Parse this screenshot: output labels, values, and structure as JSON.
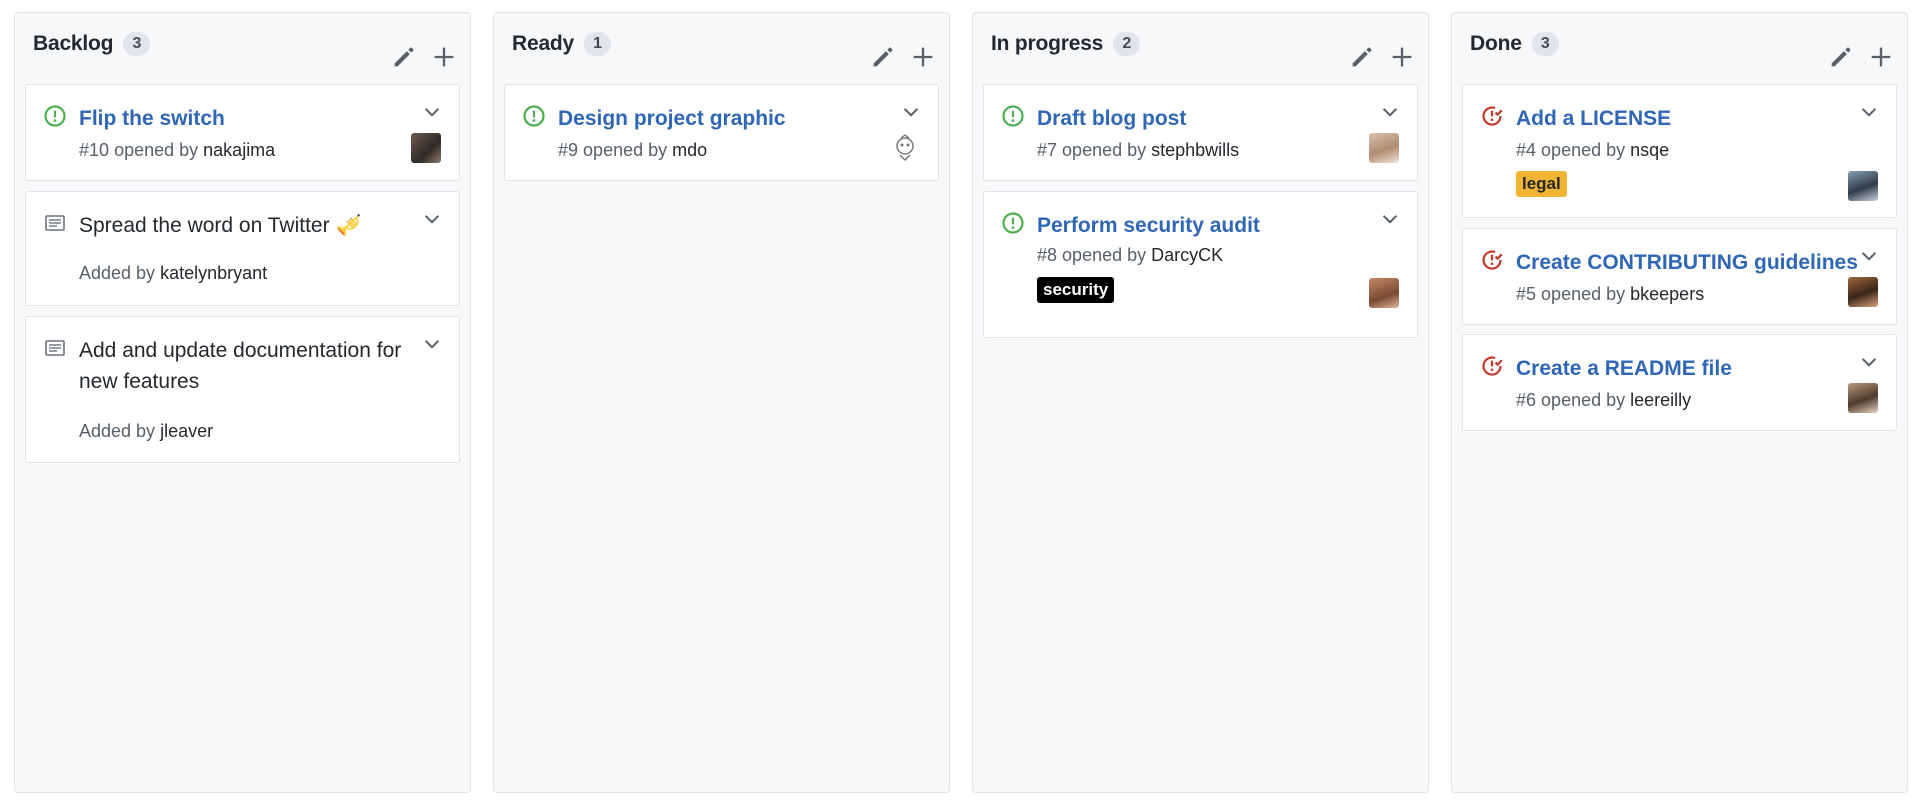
{
  "colors": {
    "open_issue": "#28a745",
    "closed_issue": "#cb2431",
    "link": "#2f67b4",
    "legal_label_bg": "#f1b434",
    "security_label_bg": "#000000"
  },
  "columns": [
    {
      "title": "Backlog",
      "count": "3",
      "cards": [
        {
          "type": "issue-open",
          "title": "Flip the switch",
          "number": "#10",
          "opened_by_text": "opened by",
          "user": "nakajima"
        },
        {
          "type": "note",
          "title": "Spread the word on Twitter",
          "emoji": "🎺",
          "added_by_text": "Added by",
          "user": "katelynbryant"
        },
        {
          "type": "note",
          "title": "Add and update documentation for new features",
          "added_by_text": "Added by",
          "user": "jleaver"
        }
      ]
    },
    {
      "title": "Ready",
      "count": "1",
      "cards": [
        {
          "type": "issue-open",
          "title": "Design project graphic",
          "number": "#9",
          "opened_by_text": "opened by",
          "user": "mdo"
        }
      ]
    },
    {
      "title": "In progress",
      "count": "2",
      "cards": [
        {
          "type": "issue-open",
          "title": "Draft blog post",
          "number": "#7",
          "opened_by_text": "opened by",
          "user": "stephbwills"
        },
        {
          "type": "issue-open",
          "title": "Perform security audit",
          "number": "#8",
          "opened_by_text": "opened by",
          "user": "DarcyCK",
          "label": "security"
        }
      ]
    },
    {
      "title": "Done",
      "count": "3",
      "cards": [
        {
          "type": "issue-closed",
          "title": "Add a LICENSE",
          "number": "#4",
          "opened_by_text": "opened by",
          "user": "nsqe",
          "label": "legal"
        },
        {
          "type": "issue-closed",
          "title": "Create CONTRIBUTING guidelines",
          "number": "#5",
          "opened_by_text": "opened by",
          "user": "bkeepers"
        },
        {
          "type": "issue-closed",
          "title": "Create a README file",
          "number": "#6",
          "opened_by_text": "opened by",
          "user": "leereilly"
        }
      ]
    }
  ],
  "icons": {
    "open_issue": "issue-opened-icon",
    "closed_issue": "issue-closed-icon",
    "note": "note-icon",
    "edit": "pencil-icon",
    "add": "plus-icon",
    "menu": "chevron-down-icon"
  }
}
